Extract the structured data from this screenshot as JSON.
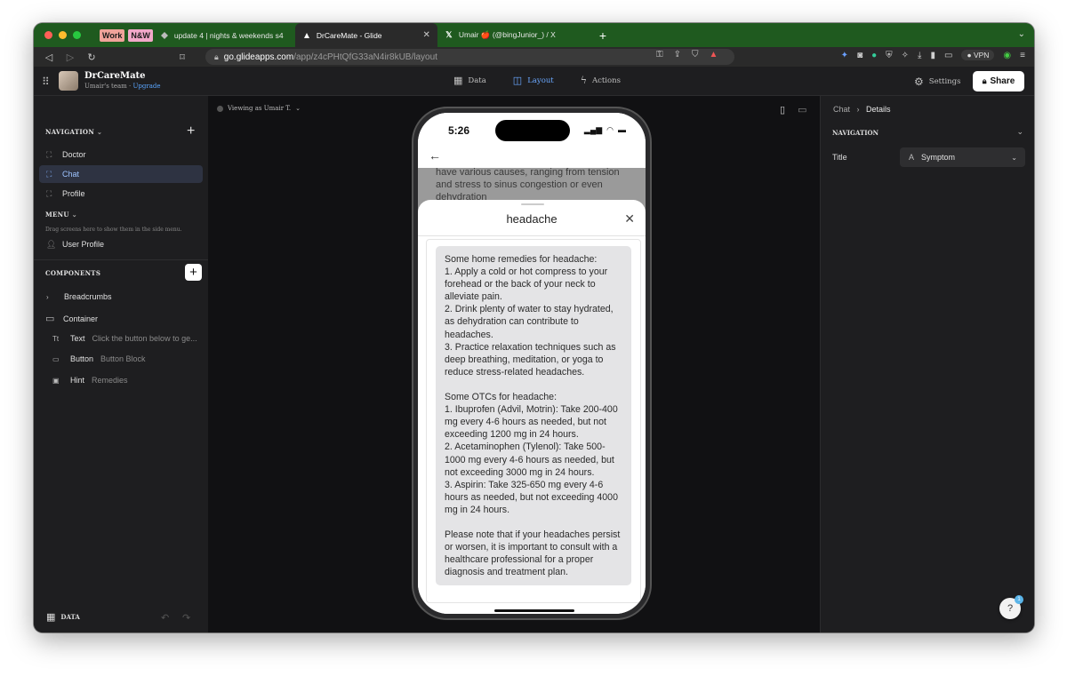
{
  "browser": {
    "tab_groups": [
      {
        "label": "Work",
        "color": "#f0a39a"
      },
      {
        "label": "N&W",
        "color": "#f2a8c9"
      }
    ],
    "tabs": [
      {
        "title": "update 4 | nights & weekends s4",
        "icon": "buildspace-icon",
        "active": false
      },
      {
        "title": "DrCareMate - Glide",
        "icon": "glide-icon",
        "active": true
      },
      {
        "title": "Umair 🍎 (@bingJunior_) / X",
        "icon": "x-logo-icon",
        "active": false
      }
    ],
    "url_host": "go.glideapps.com",
    "url_path": "/app/z4cPHtQfG33aN4ir8kUB/layout",
    "vpn_label": "VPN"
  },
  "app": {
    "name": "DrCareMate",
    "team": "Umair's team · ",
    "upgrade": "Upgrade",
    "center_tabs": [
      {
        "label": "Data",
        "icon": "table-icon"
      },
      {
        "label": "Layout",
        "icon": "layout-icon",
        "active": true
      },
      {
        "label": "Actions",
        "icon": "bolt-icon"
      }
    ],
    "settings_label": "Settings",
    "share_label": "Share"
  },
  "sidebar": {
    "navigation_title": "NAVIGATION",
    "nav_items": [
      {
        "label": "Doctor"
      },
      {
        "label": "Chat",
        "selected": true
      },
      {
        "label": "Profile"
      }
    ],
    "menu_title": "MENU",
    "menu_hint": "Drag screens here to show them in the side menu.",
    "menu_items": [
      {
        "label": "User Profile"
      }
    ],
    "components_title": "COMPONENTS",
    "components": [
      {
        "label": "Breadcrumbs",
        "sub": ""
      },
      {
        "label": "Container",
        "sub": ""
      },
      {
        "label": "Text",
        "sub": "Click the button below to ge..."
      },
      {
        "label": "Button",
        "sub": "Button Block"
      },
      {
        "label": "Hint",
        "sub": "Remedies"
      }
    ],
    "data_label": "DATA"
  },
  "canvas": {
    "viewing_as": "Viewing as Umair T."
  },
  "phone": {
    "time": "5:26",
    "background_text": "have various causes, ranging from tension and stress to sinus congestion or even dehydration",
    "sheet_title": "headache",
    "message": "Some home remedies for headache:\n1. Apply a cold or hot compress to your forehead or the back of your neck to alleviate pain.\n2. Drink plenty of water to stay hydrated, as dehydration can contribute to headaches.\n3. Practice relaxation techniques such as deep breathing, meditation, or yoga to reduce stress-related headaches.\n\nSome OTCs for headache:\n1. Ibuprofen (Advil, Motrin): Take 200-400 mg every 4-6 hours as needed, but not exceeding 1200 mg in 24 hours.\n2. Acetaminophen (Tylenol): Take 500-1000 mg every 4-6 hours as needed, but not exceeding 3000 mg in 24 hours.\n3. Aspirin: Take 325-650 mg every 4-6 hours as needed, but not exceeding 4000 mg in 24 hours.\n\nPlease note that if your headaches persist or worsen, it is important to consult with a healthcare professional for a proper diagnosis and treatment plan."
  },
  "right_panel": {
    "breadcrumb_parent": "Chat",
    "breadcrumb_current": "Details",
    "section_title": "NAVIGATION",
    "title_label": "Title",
    "title_value": "Symptom",
    "help_badge": "1"
  }
}
